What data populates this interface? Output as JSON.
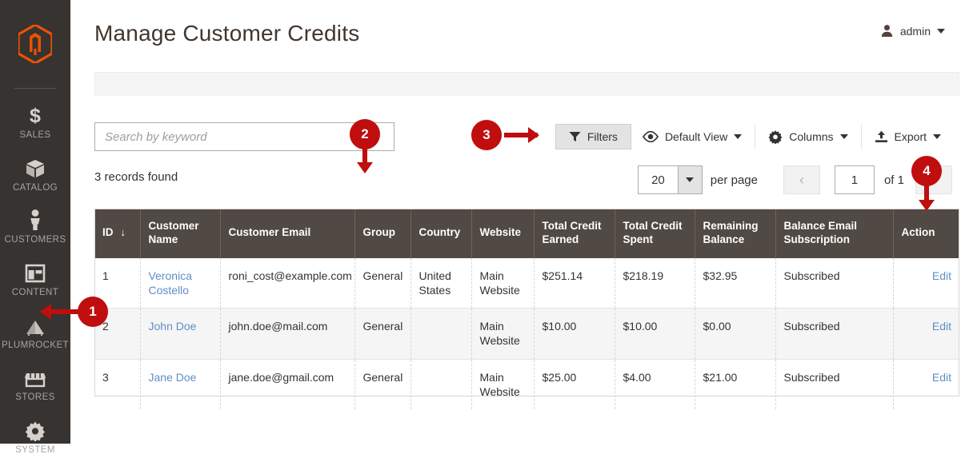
{
  "sidebar": {
    "logo": "magento-logo",
    "items": [
      {
        "label": "SALES",
        "icon": "dollar-icon"
      },
      {
        "label": "CATALOG",
        "icon": "box-icon"
      },
      {
        "label": "CUSTOMERS",
        "icon": "person-icon"
      },
      {
        "label": "CONTENT",
        "icon": "layout-icon"
      },
      {
        "label": "PLUMROCKET",
        "icon": "pyramid-icon"
      },
      {
        "label": "STORES",
        "icon": "store-icon"
      },
      {
        "label": "SYSTEM",
        "icon": "gear-icon"
      }
    ]
  },
  "header": {
    "title": "Manage Customer Credits",
    "user": {
      "name": "admin",
      "icon": "user-icon",
      "caret": "chevron-down-icon"
    }
  },
  "toolbar": {
    "search": {
      "placeholder": "Search by keyword",
      "value": ""
    },
    "filters_label": "Filters",
    "view_label": "Default View",
    "columns_label": "Columns",
    "export_label": "Export"
  },
  "listing": {
    "records_found": "3 records found",
    "per_page_value": "20",
    "per_page_label": "per page",
    "page_value": "1",
    "page_total_label": "of 1"
  },
  "table": {
    "columns": [
      "ID",
      "Customer Name",
      "Customer Email",
      "Group",
      "Country",
      "Website",
      "Total Credit Earned",
      "Total Credit Spent",
      "Remaining Balance",
      "Balance Email Subscription",
      "Action"
    ],
    "sort_column": "ID",
    "sort_indicator": "↓",
    "rows": [
      {
        "id": "1",
        "customer_name": "Veronica Costello",
        "customer_email": "roni_cost@example.com",
        "group": "General",
        "country": "United States",
        "website": "Main Website",
        "total_credit_earned": "$251.14",
        "total_credit_spent": "$218.19",
        "remaining_balance": "$32.95",
        "balance_email_subscription": "Subscribed",
        "action": "Edit"
      },
      {
        "id": "2",
        "customer_name": "John Doe",
        "customer_email": "john.doe@mail.com",
        "group": "General",
        "country": "",
        "website": "Main Website",
        "total_credit_earned": "$10.00",
        "total_credit_spent": "$10.00",
        "remaining_balance": "$0.00",
        "balance_email_subscription": "Subscribed",
        "action": "Edit"
      },
      {
        "id": "3",
        "customer_name": "Jane Doe",
        "customer_email": "jane.doe@gmail.com",
        "group": "General",
        "country": "",
        "website": "Main Website",
        "total_credit_earned": "$25.00",
        "total_credit_spent": "$4.00",
        "remaining_balance": "$21.00",
        "balance_email_subscription": "Subscribed",
        "action": "Edit"
      }
    ]
  },
  "annotations": [
    {
      "number": "1",
      "points_to": "sidebar-item-plumrocket",
      "direction": "left"
    },
    {
      "number": "2",
      "points_to": "search-input",
      "direction": "down"
    },
    {
      "number": "3",
      "points_to": "filters-button",
      "direction": "right"
    },
    {
      "number": "4",
      "points_to": "next-page-button",
      "direction": "down"
    }
  ],
  "colors": {
    "accent": "#eb5202",
    "sidebar_bg": "#373330",
    "table_header_bg": "#514943",
    "link": "#5e8fc4",
    "annotation": "#c00d0d"
  }
}
